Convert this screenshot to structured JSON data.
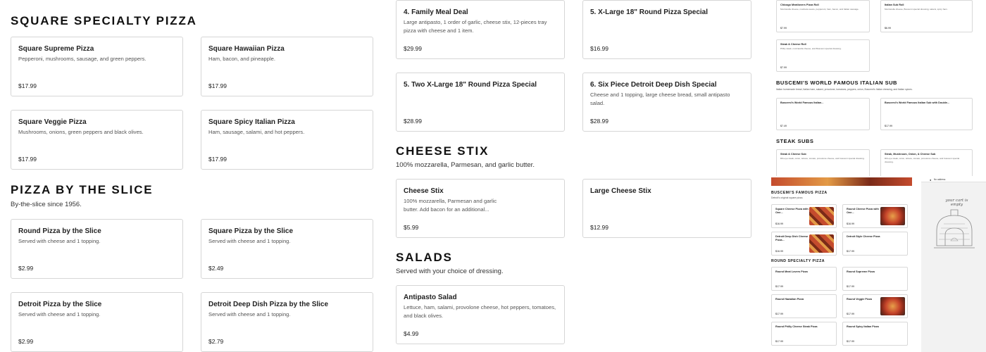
{
  "left_column": {
    "square_section": {
      "title": "Square Specialty Pizza",
      "items": [
        {
          "name": "Square Supreme Pizza",
          "desc": "Pepperoni, mushrooms, sausage, and green peppers.",
          "price": "$17.99"
        },
        {
          "name": "Square Hawaiian Pizza",
          "desc": "Ham, bacon, and pineapple.",
          "price": "$17.99"
        },
        {
          "name": "Square Veggie Pizza",
          "desc": "Mushrooms, onions, green peppers and black olives.",
          "price": "$17.99"
        },
        {
          "name": "Square Spicy Italian Pizza",
          "desc": "Ham, sausage, salami, and hot peppers.",
          "price": "$17.99"
        }
      ]
    },
    "slice_section": {
      "title": "Pizza by the Slice",
      "subtitle": "By-the-slice since 1956.",
      "items": [
        {
          "name": "Round Pizza by the Slice",
          "desc": "Served with cheese and 1 topping.",
          "price": "$2.99"
        },
        {
          "name": "Square Pizza by the Slice",
          "desc": "Served with cheese and 1 topping.",
          "price": "$2.49"
        },
        {
          "name": "Detroit Pizza by the Slice",
          "desc": "Served with cheese and 1 topping.",
          "price": "$2.99"
        },
        {
          "name": "Detroit Deep Dish Pizza by the Slice",
          "desc": "Served with cheese and 1 topping.",
          "price": "$2.79"
        }
      ]
    }
  },
  "middle_column": {
    "deals": [
      {
        "name": "4. Family Meal Deal",
        "desc": "Large antipasto, 1 order of garlic, cheese stix, 12-pieces tray pizza with cheese and 1 item.",
        "price": "$29.99"
      },
      {
        "name": "5. X-Large 18\" Round Pizza Special",
        "desc": "",
        "price": "$16.99"
      },
      {
        "name": "5. Two X-Large 18\" Round Pizza Special",
        "desc": "",
        "price": "$28.99"
      },
      {
        "name": "6. Six Piece Detroit Deep Dish Special",
        "desc": "Cheese and 1 topping, large cheese bread, small antipasto salad.",
        "price": "$28.99"
      }
    ],
    "stix_section": {
      "title": "Cheese Stix",
      "subtitle": "100% mozzarella, Parmesan, and garlic butter.",
      "items": [
        {
          "name": "Cheese Stix",
          "desc": "100% mozzarella, Parmesan and garlic butter. Add bacon for an additional...",
          "price": "$5.99"
        },
        {
          "name": "Large Cheese Stix",
          "desc": "",
          "price": "$12.99"
        }
      ]
    },
    "salads_section": {
      "title": "Salads",
      "subtitle": "Served with your choice of dressing.",
      "items": [
        {
          "name": "Antipasto Salad",
          "desc": "Lettuce, ham, salami, provolone cheese, hot peppers, tomatoes, and black olives.",
          "price": "$4.99"
        }
      ]
    }
  },
  "thumbnail_top": {
    "rolls": [
      {
        "name": "Chicago Meatlovers Pizza Roll",
        "desc": "Mozzarella cheese, marinara sauce, pepperoni, ham, bacon, and Italian sausage.",
        "price": "$7.99"
      },
      {
        "name": "Italian Sub Roll",
        "desc": "Mozzarella cheese, Buscemi special dressing, salami, spicy ham.",
        "price": "$6.99"
      },
      {
        "name": "Steak & Cheese Roll",
        "desc": "Philly steak, mozzarella cheese, and Buscemi special dressing.",
        "price": "$7.99"
      }
    ],
    "sub_title": "Buscemi's World Famous Italian Sub",
    "sub_subtitle": "Italian homemade bread, Italian ham, salami, provolone, tomatoes, peppers, onion, Buscemi's Italian dressing, and Italian spices.",
    "subs": [
      {
        "name": "Buscemi's World Famous Italian...",
        "price": "$7.49"
      },
      {
        "name": "Buscemi's World Famous Italian Sub with Double...",
        "price": "$17.99"
      }
    ],
    "steak_title": "Steak Subs",
    "steaks": [
      {
        "name": "Steak & Cheese Sub",
        "desc": "Rib-eye steak, onion, lettuce, tomato, provolone cheese, and buscemi special dressing."
      },
      {
        "name": "Steak, Mushroom, Onion, & Cheese Sub",
        "desc": "Rib-eye steak, onion, lettuce, tomato, provolone cheese, and buscemi special dressing."
      }
    ]
  },
  "thumbnail_bottom": {
    "famous_title": "Buscemi's Famous Pizza",
    "famous_sub": "Detroit's original square pizza.",
    "famous": [
      {
        "name": "Square Cheese Pizza with One...",
        "price": "$16.99"
      },
      {
        "name": "Round Cheese Pizza with One...",
        "price": "$16.99"
      },
      {
        "name": "Detroit Deep Dish Cheese Pizza...",
        "price": "$16.99"
      },
      {
        "name": "Detroit Style Cheese Pizza",
        "price": "$17.99"
      }
    ],
    "round_title": "Round Specialty Pizza",
    "round": [
      {
        "name": "Round Meat Lovers Pizza",
        "price": "$17.99"
      },
      {
        "name": "Round Supreme Pizza",
        "price": "$17.99"
      },
      {
        "name": "Round Hawaiian Pizza",
        "price": "$17.99"
      },
      {
        "name": "Round Veggie Pizza",
        "price": "$17.99"
      },
      {
        "name": "Round Philly Cheese Steak Pizza",
        "price": "$17.99"
      },
      {
        "name": "Round Spicy Italian Pizza",
        "price": "$17.99"
      }
    ],
    "cart_label": "No address",
    "cart_empty_text": "your cart is empty"
  }
}
